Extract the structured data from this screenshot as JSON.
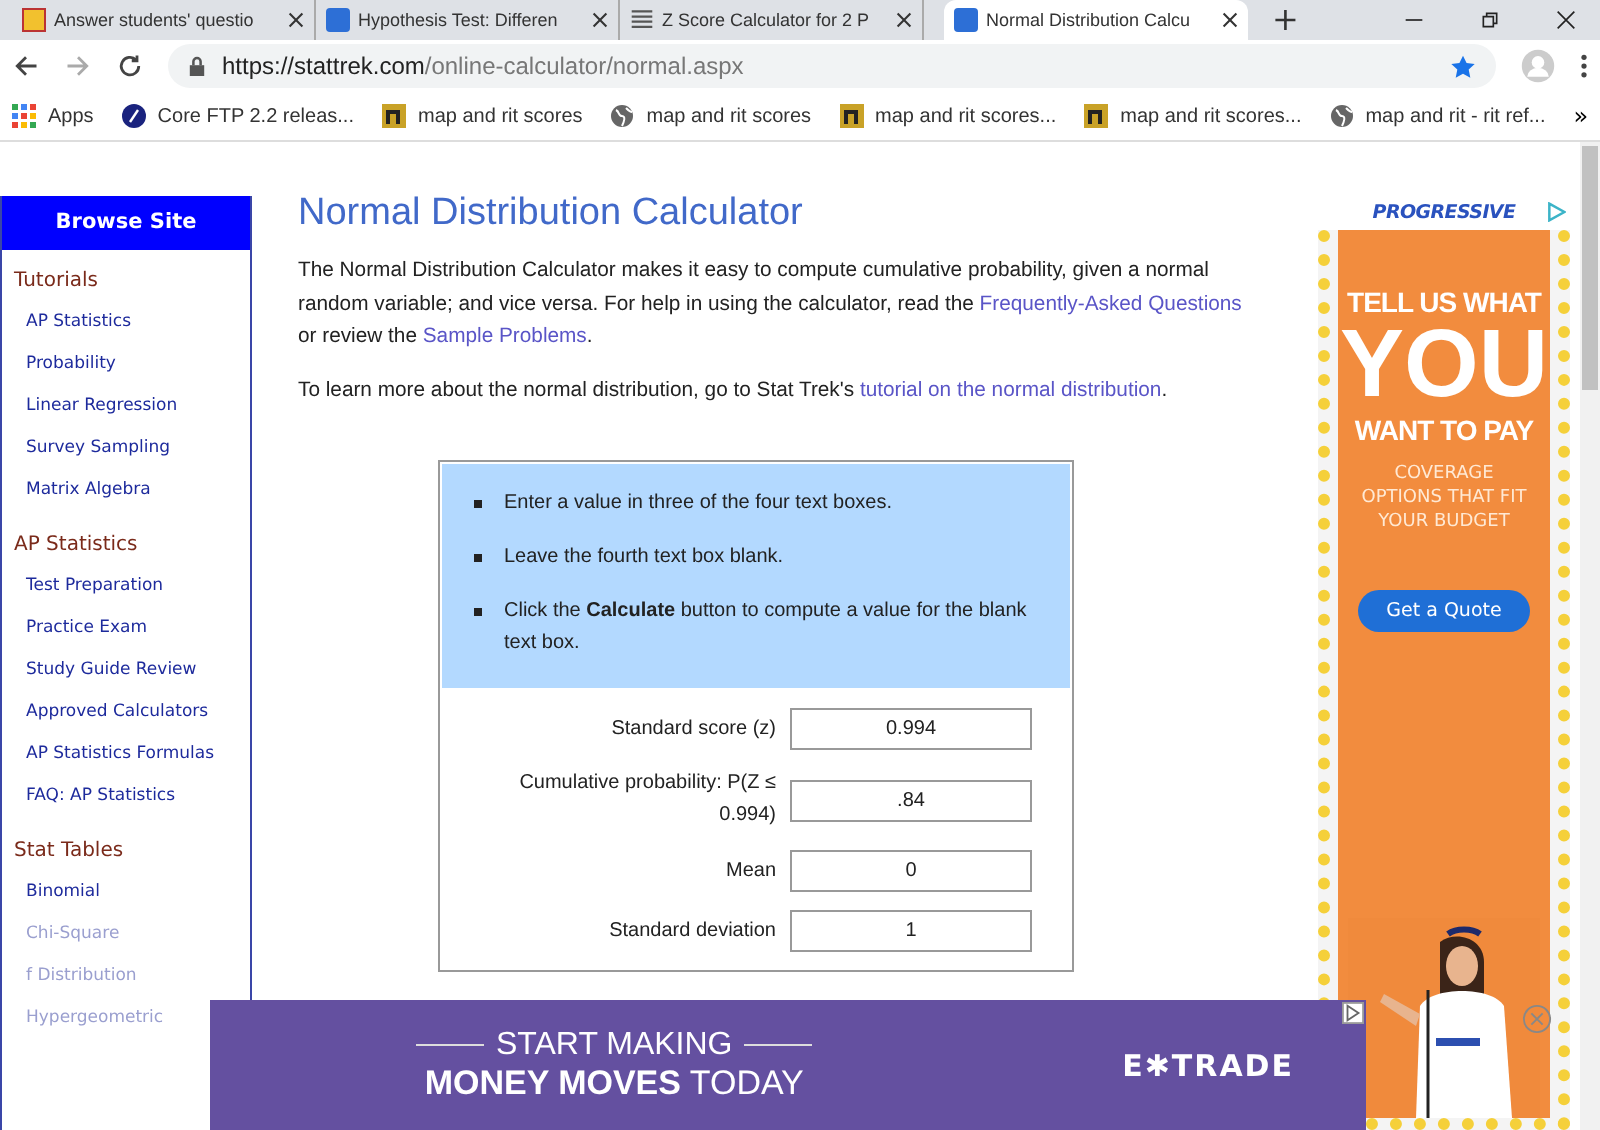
{
  "browser": {
    "tabs": [
      {
        "title": "Answer students' questio",
        "kind": "ya",
        "selected": false
      },
      {
        "title": "Hypothesis Test: Differen",
        "kind": "st",
        "selected": false
      },
      {
        "title": "Z Score Calculator for 2 P",
        "kind": "lines",
        "selected": false
      },
      {
        "title": "Normal Distribution Calcu",
        "kind": "st",
        "selected": true
      }
    ],
    "new_tab": "+",
    "url_host": "https://stattrek.com",
    "url_path": "/online-calculator/normal.aspx",
    "bookmarks": [
      {
        "label": "Apps",
        "kind": "apps"
      },
      {
        "label": "Core FTP 2.2 releas...",
        "kind": "disc"
      },
      {
        "label": "map and rit scores",
        "kind": "n"
      },
      {
        "label": "map and rit scores",
        "kind": "globe"
      },
      {
        "label": "map and rit scores...",
        "kind": "n"
      },
      {
        "label": "map and rit scores...",
        "kind": "n"
      },
      {
        "label": "map and rit - rit ref...",
        "kind": "globe"
      }
    ],
    "more": "»"
  },
  "sidebar": {
    "header": "Browse Site",
    "sections": [
      {
        "title": "Tutorials",
        "items": [
          {
            "label": "AP Statistics",
            "dimmed": false
          },
          {
            "label": "Probability",
            "dimmed": false
          },
          {
            "label": "Linear Regression",
            "dimmed": false
          },
          {
            "label": "Survey Sampling",
            "dimmed": false
          },
          {
            "label": "Matrix Algebra",
            "dimmed": false
          }
        ]
      },
      {
        "title": "AP Statistics",
        "items": [
          {
            "label": "Test Preparation",
            "dimmed": false
          },
          {
            "label": "Practice Exam",
            "dimmed": false
          },
          {
            "label": "Study Guide Review",
            "dimmed": false
          },
          {
            "label": "Approved Calculators",
            "dimmed": false
          },
          {
            "label": "AP Statistics Formulas",
            "dimmed": false
          },
          {
            "label": "FAQ: AP Statistics",
            "dimmed": false
          }
        ]
      },
      {
        "title": "Stat Tables",
        "items": [
          {
            "label": "Binomial",
            "dimmed": false
          },
          {
            "label": "Chi-Square",
            "dimmed": true
          },
          {
            "label": "f Distribution",
            "dimmed": true
          },
          {
            "label": "Hypergeometric",
            "dimmed": true
          }
        ]
      }
    ]
  },
  "main": {
    "title": "Normal Distribution Calculator",
    "paragraphs": [
      [
        {
          "kind": "text",
          "text": "The Normal Distribution Calculator makes it easy to compute cumulative probability, given a normal random variable; and vice versa. For help in using the calculator, read the"
        },
        {
          "kind": "link",
          "text": "Frequently-Asked Questions"
        },
        {
          "kind": "text",
          "text": "or review the"
        },
        {
          "kind": "link",
          "text": "Sample Problems"
        },
        {
          "kind": "text",
          "text": "."
        }
      ],
      [
        {
          "kind": "text",
          "text": "To learn more about the normal distribution, go to Stat Trek's"
        },
        {
          "kind": "link",
          "text": "tutorial on the normal distribution"
        },
        {
          "kind": "text",
          "text": "."
        }
      ]
    ],
    "instructions": [
      "Enter a value in three of the four text boxes.",
      "Leave the fourth text box blank.",
      "Click the **Calculate** button to compute a value for the blank text box."
    ],
    "fields": [
      {
        "label": "Standard score (z)",
        "value": "0.994"
      },
      {
        "label": "Cumulative probability: P(Z ≤ 0.994)",
        "value": ".84"
      },
      {
        "label": "Mean",
        "value": "0"
      },
      {
        "label": "Standard deviation",
        "value": "1"
      }
    ]
  },
  "side_ad": {
    "brand": "PROGRESSIVE",
    "line_1": "TELL US WHAT",
    "line_2": "YOU",
    "line_3": "WANT TO PAY",
    "line_4": "COVERAGE OPTIONS THAT FIT YOUR BUDGET",
    "button": "Get a Quote"
  },
  "banner_ad": {
    "line_1": "START MAKING",
    "line_2": "**MONEY MOVES** TODAY",
    "brand": "E✱TRADE"
  }
}
